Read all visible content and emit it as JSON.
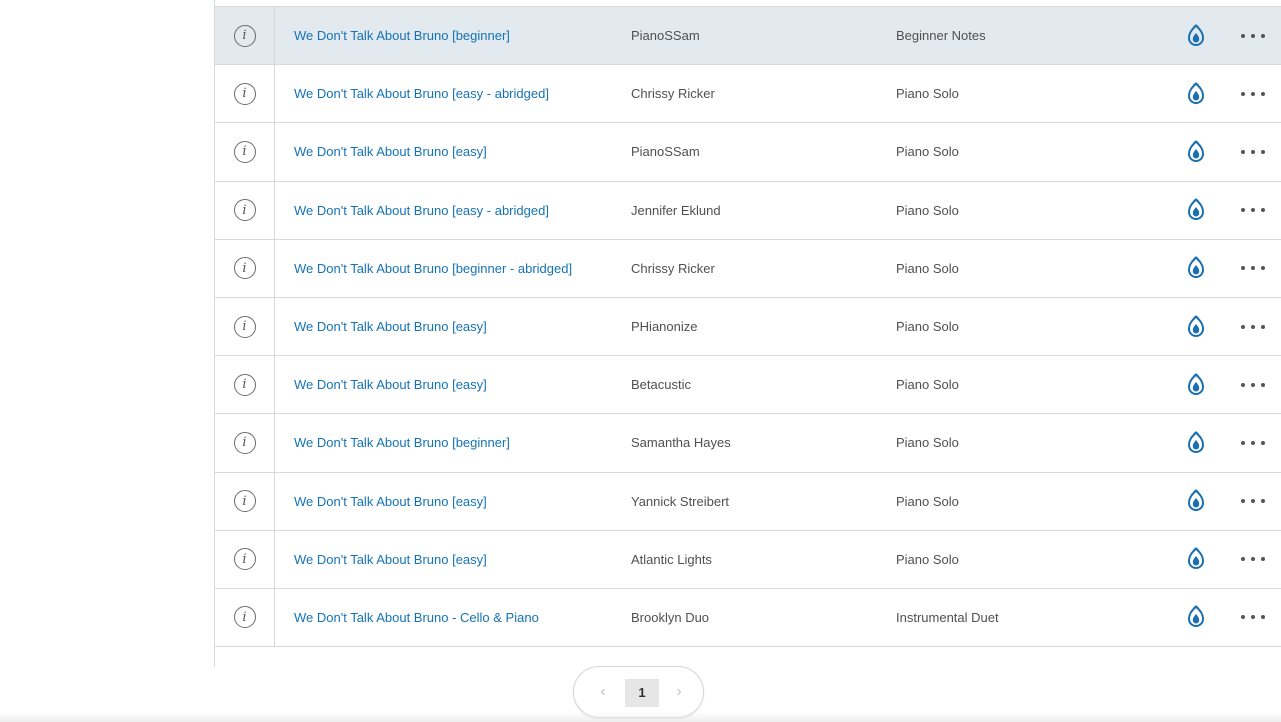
{
  "colors": {
    "link": "#1573b5",
    "text": "#505050",
    "highlight_row": "#e2e9ef",
    "border": "#d9d9d9",
    "app_icon": "#1a6fb0"
  },
  "icons": {
    "info": "i",
    "prev": "‹",
    "next": "›"
  },
  "rows": [
    {
      "title": "We Don't Talk About Bruno [beginner]",
      "artist": "PianoSSam",
      "type": "Beginner Notes",
      "highlighted": true
    },
    {
      "title": "We Don't Talk About Bruno [easy - abridged]",
      "artist": "Chrissy Ricker",
      "type": "Piano Solo"
    },
    {
      "title": "We Don't Talk About Bruno [easy]",
      "artist": "PianoSSam",
      "type": "Piano Solo"
    },
    {
      "title": "We Don't Talk About Bruno [easy - abridged]",
      "artist": "Jennifer Eklund",
      "type": "Piano Solo"
    },
    {
      "title": "We Don't Talk About Bruno [beginner - abridged]",
      "artist": "Chrissy Ricker",
      "type": "Piano Solo"
    },
    {
      "title": "We Don't Talk About Bruno [easy]",
      "artist": "PHianonize",
      "type": "Piano Solo"
    },
    {
      "title": "We Don't Talk About Bruno [easy]",
      "artist": "Betacustic",
      "type": "Piano Solo"
    },
    {
      "title": "We Don't Talk About Bruno [beginner]",
      "artist": "Samantha Hayes",
      "type": "Piano Solo"
    },
    {
      "title": "We Don't Talk About Bruno [easy]",
      "artist": "Yannick Streibert",
      "type": "Piano Solo"
    },
    {
      "title": "We Don't Talk About Bruno [easy]",
      "artist": "Atlantic Lights",
      "type": "Piano Solo"
    },
    {
      "title": "We Don't Talk About Bruno - Cello & Piano",
      "artist": "Brooklyn Duo",
      "type": "Instrumental Duet"
    }
  ],
  "pagination": {
    "current_page": "1"
  }
}
